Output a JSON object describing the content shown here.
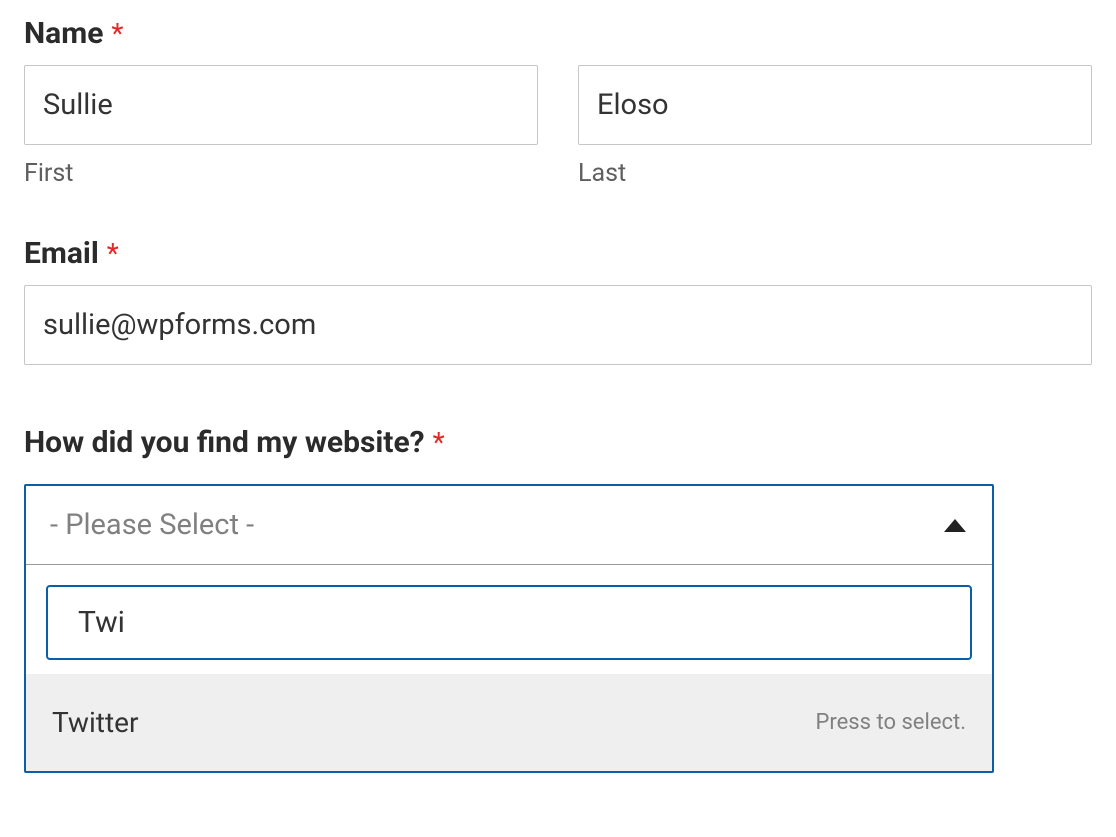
{
  "name": {
    "label": "Name",
    "required": "*",
    "first": {
      "value": "Sullie",
      "sublabel": "First"
    },
    "last": {
      "value": "Eloso",
      "sublabel": "Last"
    }
  },
  "email": {
    "label": "Email",
    "required": "*",
    "value": "sullie@wpforms.com"
  },
  "source": {
    "label": "How did you find my website?",
    "required": "*",
    "placeholder": "- Please Select -",
    "search_value": "Twi",
    "option": {
      "text": "Twitter",
      "hint": "Press to select."
    }
  }
}
